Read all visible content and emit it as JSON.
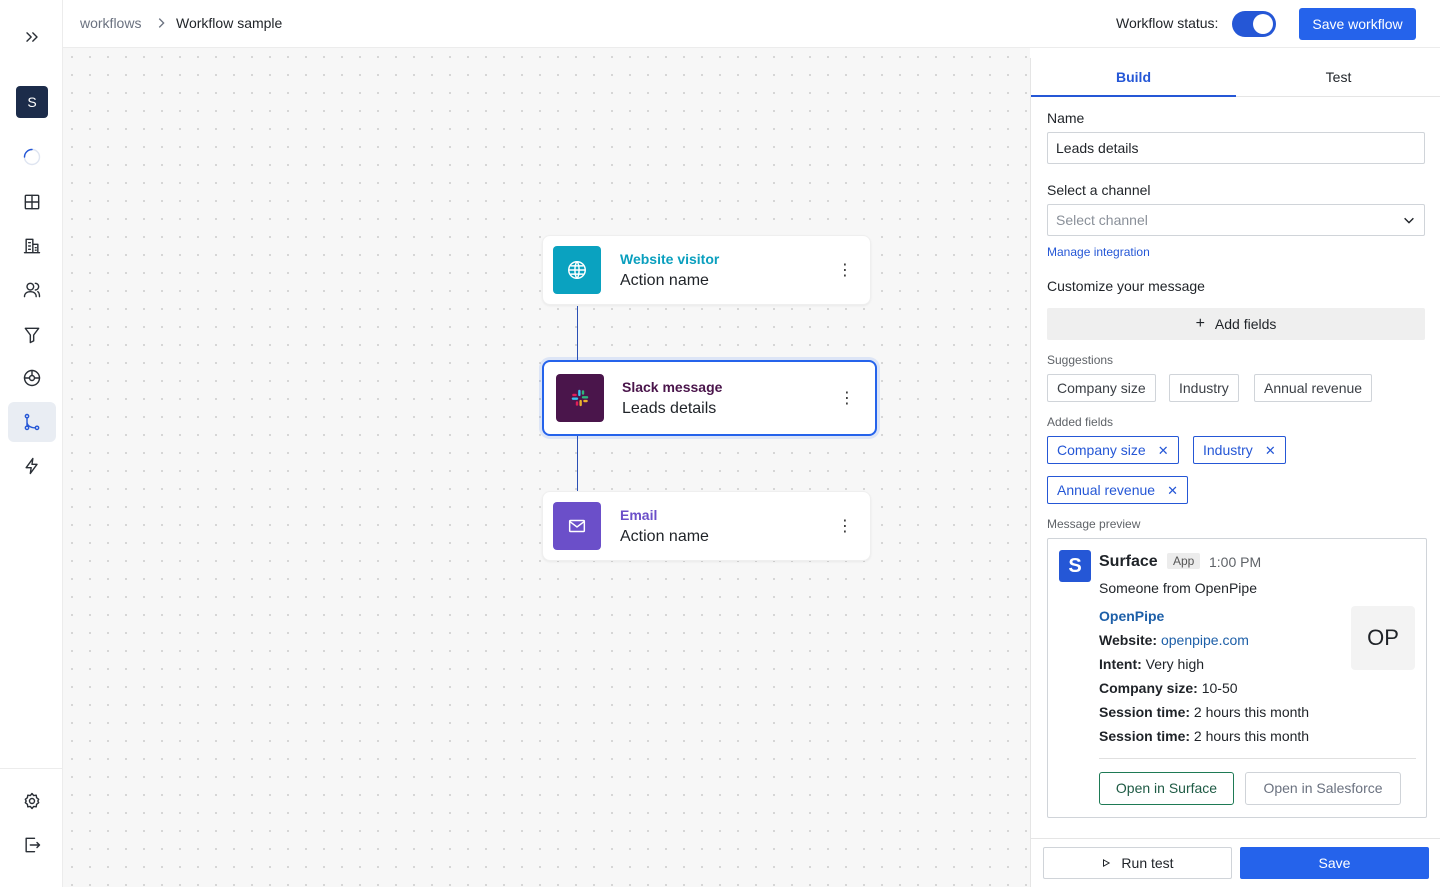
{
  "breadcrumb": {
    "parent": "workflows",
    "current": "Workflow sample"
  },
  "header": {
    "status_label": "Workflow status:",
    "status_on": true,
    "save_workflow": "Save workflow"
  },
  "sidebar": {
    "avatar_letter": "S",
    "items": [
      {
        "icon": "expand-icon"
      },
      {
        "icon": "loading-icon"
      },
      {
        "icon": "grid-icon"
      },
      {
        "icon": "building-icon"
      },
      {
        "icon": "users-icon"
      },
      {
        "icon": "filter-icon"
      },
      {
        "icon": "ball-icon"
      },
      {
        "icon": "workflow-icon",
        "active": true
      },
      {
        "icon": "lightning-icon"
      },
      {
        "icon": "settings-icon"
      },
      {
        "icon": "logout-icon"
      }
    ]
  },
  "nodes": [
    {
      "type": "Website visitor",
      "name": "Action name",
      "icon": "globe-icon",
      "color": "#0aa2c0",
      "type_color": "#0a9fbe"
    },
    {
      "type": "Slack message",
      "name": "Leads details",
      "icon": "slack-icon",
      "color": "#4a154b",
      "type_color": "#4a154b",
      "selected": true
    },
    {
      "type": "Email",
      "name": "Action name",
      "icon": "mail-icon",
      "color": "#6b4fc9",
      "type_color": "#6b4fc9"
    }
  ],
  "panel": {
    "tabs": [
      "Build",
      "Test"
    ],
    "active_tab": "Build",
    "name_label": "Name",
    "name_value": "Leads details",
    "channel_label": "Select a channel",
    "channel_placeholder": "Select channel",
    "manage_link": "Manage integration",
    "customize_label": "Customize your message",
    "add_fields": "Add fields",
    "suggestions_label": "Suggestions",
    "suggestions": [
      "Company size",
      "Industry",
      "Annual revenue"
    ],
    "added_label": "Added fields",
    "added_fields": [
      "Company size",
      "Industry",
      "Annual revenue"
    ],
    "preview_label": "Message preview",
    "preview": {
      "sender": "Surface",
      "sender_initial": "S",
      "badge": "App",
      "time": "1:00 PM",
      "intro": "Someone from OpenPipe",
      "company": "OpenPipe",
      "company_initials": "OP",
      "website_key": "Website:",
      "website_val": "openpipe.com",
      "intent_key": "Intent:",
      "intent_val": "Very high",
      "size_key": "Company size:",
      "size_val": "10-50",
      "session1_key": "Session time:",
      "session1_val": "2 hours this month",
      "session2_key": "Session time:",
      "session2_val": "2 hours this month",
      "btn_surface": "Open in Surface",
      "btn_salesforce": "Open in Salesforce"
    },
    "run_test": "Run test",
    "save": "Save"
  },
  "colors": {
    "accent": "#2563eb",
    "brand_dark": "#1c2c4a"
  }
}
